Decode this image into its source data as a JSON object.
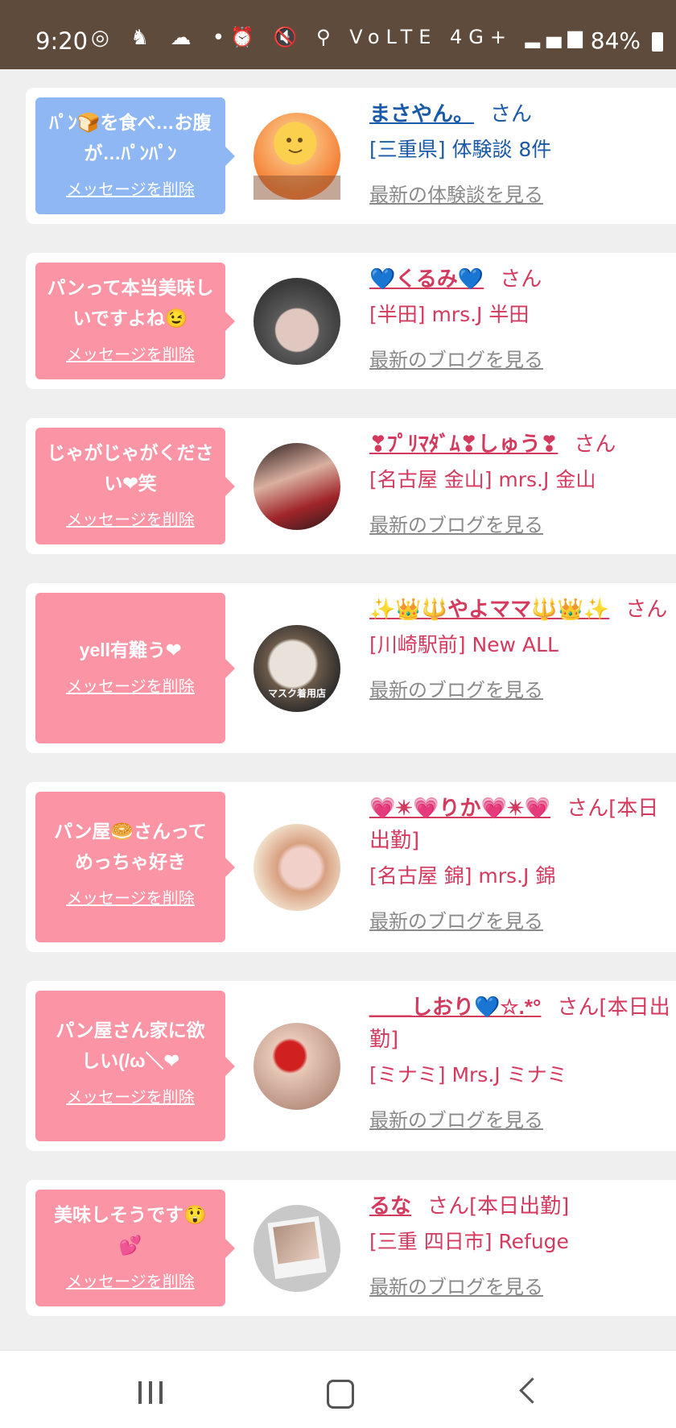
{
  "status_bar": {
    "time": "9:20",
    "left_icons": "◎ ♞ ☁ •",
    "right_icons": "⏰ 🔇 ⚲ VoLTE 4G+ ▂▄▆",
    "battery": "84%"
  },
  "delete_label": "メッセージを削除",
  "cards": [
    {
      "message": "ﾊﾟﾝ🍞を食べ…お腹が…ﾊﾟﾝﾊﾟﾝ",
      "delete": "メッセージを削除",
      "name": "まさやん。",
      "honorific": "さん",
      "shop": "[三重県] 体験談 8件",
      "latest": "最新の体験談を見る",
      "theme": "blue",
      "avatar_colors": [
        "#fbd04f",
        "#f47c34",
        "#f9b571"
      ]
    },
    {
      "message": "パンって本当美味しいですよね😉",
      "delete": "メッセージを削除",
      "name": "💙くるみ💙",
      "honorific": "さん",
      "shop": "[半田] mrs.J 半田",
      "latest": "最新のブログを見る",
      "theme": "pink",
      "avatar_colors": [
        "#5a5a5a",
        "#e0c8c0",
        "#3a3a3a"
      ]
    },
    {
      "message": "じゃがじゃがください❤笑",
      "delete": "メッセージを削除",
      "name": "❣ﾌﾟﾘﾏﾀﾞﾑ❣しゅう❣",
      "honorific": "さん",
      "shop": "[名古屋 金山] mrs.J 金山",
      "latest": "最新のブログを見る",
      "theme": "pink",
      "avatar_colors": [
        "#2a1a1a",
        "#a0252a",
        "#d9b0a0"
      ]
    },
    {
      "message": "yell有難う❤",
      "delete": "メッセージを削除",
      "name": "✨👑🔱やよママ🔱👑✨",
      "honorific": "さん",
      "shop": "[川崎駅前] New ALL",
      "latest": "最新のブログを見る",
      "theme": "pink",
      "avatar_colors": [
        "#e8e2da",
        "#6b5a4a",
        "#2a2a2a"
      ],
      "avatar_caption": "マスク着用店"
    },
    {
      "message": "パン屋🥯さんってめっちゃ好き",
      "delete": "メッセージを削除",
      "name": "💗✴💗りか💗✴💗",
      "honorific": "さん[本日出勤]",
      "shop": "[名古屋 錦] mrs.J 錦",
      "latest": "最新のブログを見る",
      "theme": "pink",
      "avatar_colors": [
        "#f3e4d0",
        "#d8a080",
        "#f0d0c8"
      ]
    },
    {
      "message": "パン屋さん家に欲しい(/ω＼❤",
      "delete": "メッセージを削除",
      "name": "＿＿しおり💙☆.*°",
      "honorific": "さん[本日出勤]",
      "shop": "[ミナミ] Mrs.J ミナミ",
      "latest": "最新のブログを見る",
      "theme": "pink",
      "avatar_colors": [
        "#e8c8b8",
        "#d02020",
        "#b89080"
      ]
    },
    {
      "message": "美味しそうです😲💕",
      "delete": "メッセージを削除",
      "name": "るな",
      "honorific": "さん[本日出勤]",
      "shop": "[三重 四日市] Refuge",
      "latest": "最新のブログを見る",
      "theme": "pink",
      "avatar_colors": [
        "#c8c8c8",
        "#f4f4f4",
        "#b09080"
      ]
    }
  ]
}
